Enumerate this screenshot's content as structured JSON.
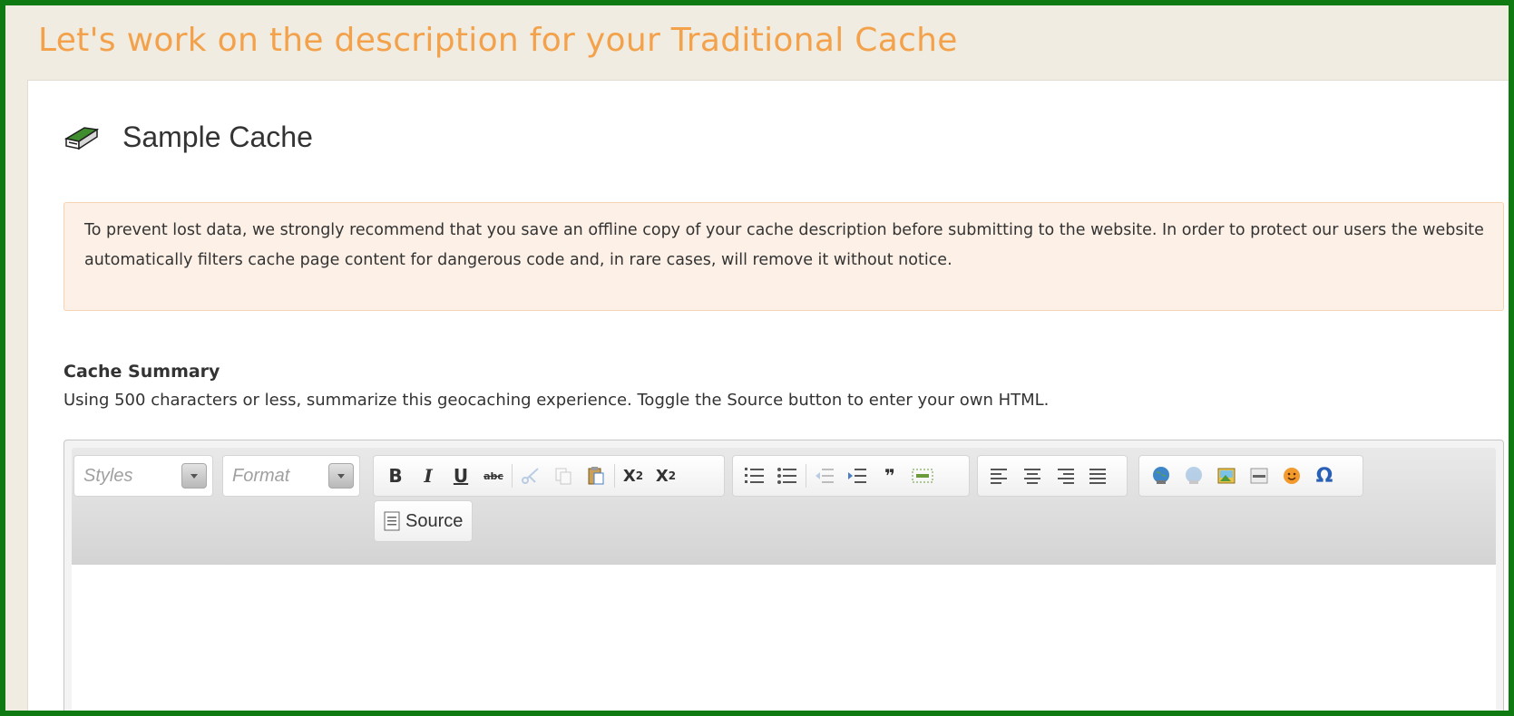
{
  "page": {
    "title": "Let's work on the description for your Traditional Cache"
  },
  "cache": {
    "name": "Sample Cache",
    "icon": "cache-box-icon"
  },
  "notice": {
    "text": "To prevent lost data, we strongly recommend that you save an offline copy of your cache description before submitting to the website. In order to protect our users the website automatically filters cache page content for dangerous code and, in rare cases, will remove it without notice."
  },
  "summary": {
    "label": "Cache Summary",
    "help": "Using 500 characters or less, summarize this geocaching experience. Toggle the Source button to enter your own HTML."
  },
  "editor": {
    "styles_label": "Styles",
    "format_label": "Format",
    "bold": "B",
    "italic": "I",
    "underline": "U",
    "strike": "abc",
    "subscript": "X",
    "subscript_mark": "2",
    "superscript": "X",
    "superscript_mark": "2",
    "blockquote": "❞",
    "source_label": "Source",
    "content": ""
  },
  "colors": {
    "frame_border": "#0f7a12",
    "title": "#f3a24b",
    "notice_bg": "#fdf1e7"
  }
}
